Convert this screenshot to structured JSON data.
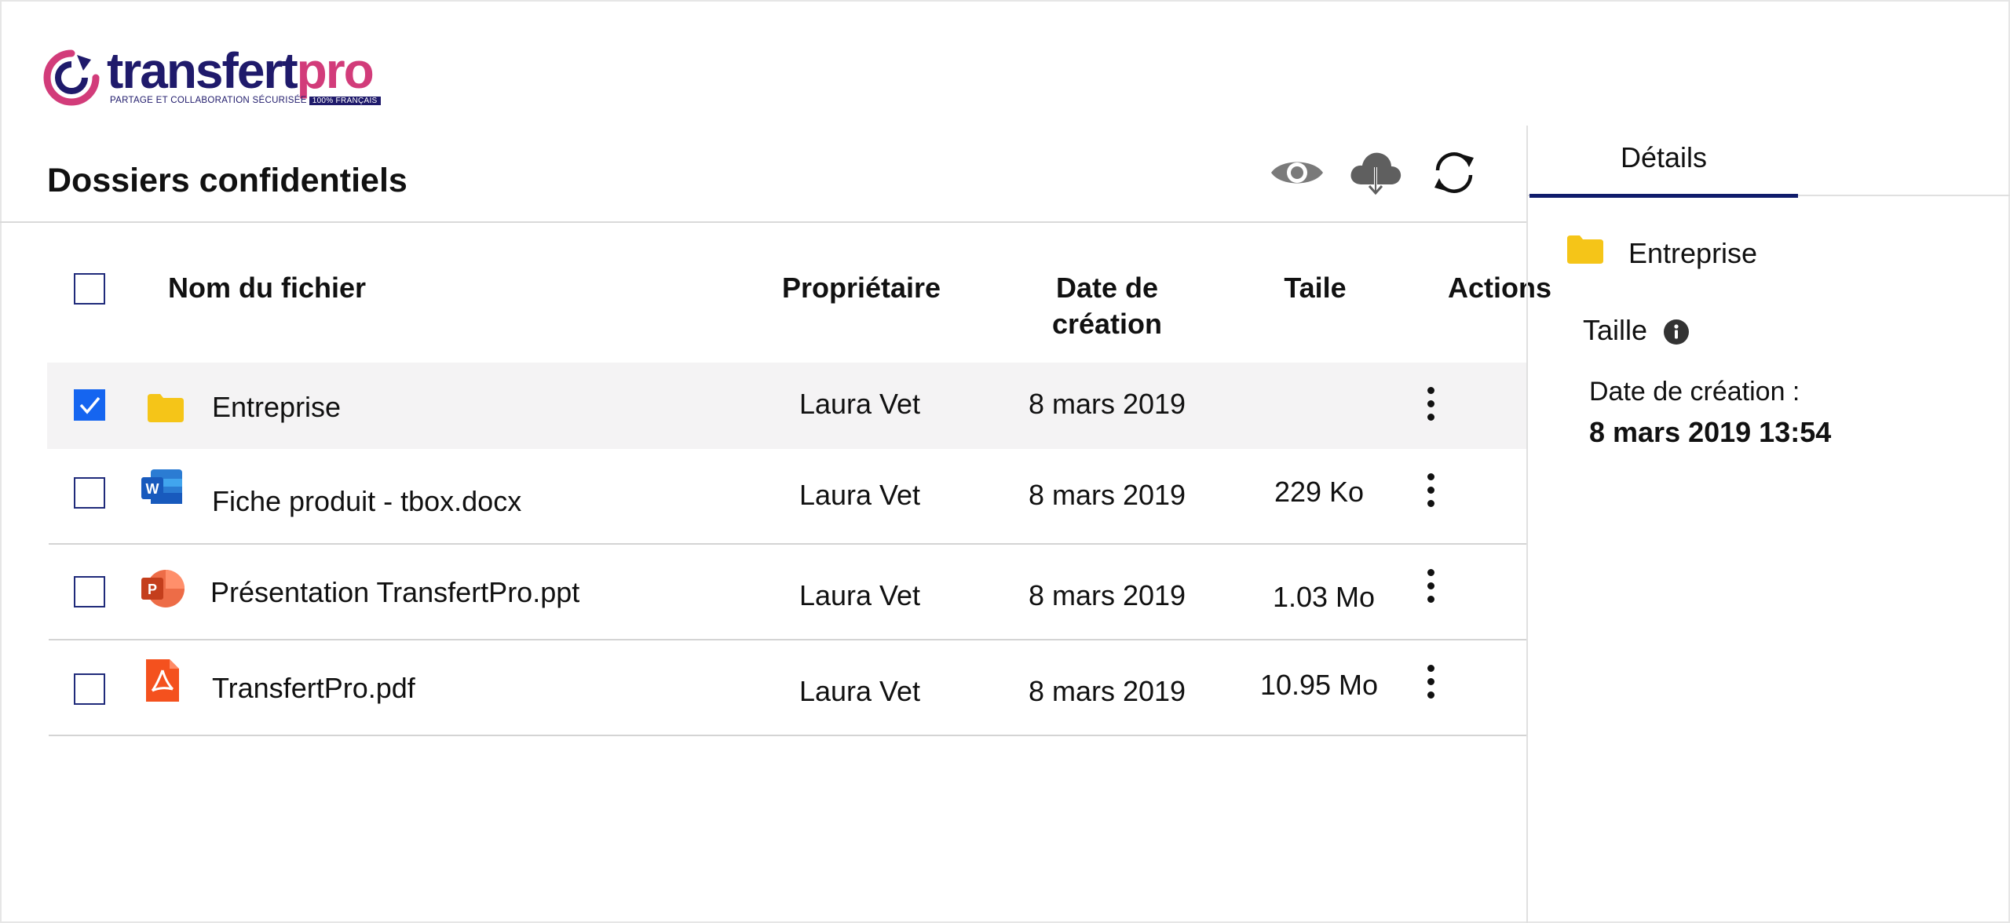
{
  "brand": {
    "name_part1": "transfert",
    "name_part2": "pro",
    "tagline": "PARTAGE ET COLLABORATION SÉCURISÉE",
    "badge": "100% FRANÇAIS",
    "colors": {
      "navy": "#1f1a6b",
      "pink": "#d23c7a"
    }
  },
  "page": {
    "title": "Dossiers confidentiels"
  },
  "toolbar": {
    "icons": [
      "eye-icon",
      "cloud-download-icon",
      "refresh-icon"
    ]
  },
  "table": {
    "columns": {
      "name": "Nom du fichier",
      "owner": "Propriétaire",
      "created_line1": "Date de",
      "created_line2": "création",
      "size": "Taile",
      "actions": "Actions"
    },
    "rows": [
      {
        "name": "Entreprise",
        "type": "folder",
        "owner": "Laura Vet",
        "date": "8 mars 2019",
        "size": "",
        "checked": true
      },
      {
        "name": "Fiche produit - tbox.docx",
        "type": "word",
        "owner": "Laura Vet",
        "date": "8 mars 2019",
        "size": "229 Ko",
        "checked": false
      },
      {
        "name": "Présentation TransfertPro.ppt",
        "type": "powerpoint",
        "owner": "Laura Vet",
        "date": "8 mars 2019",
        "size": "1.03 Mo",
        "checked": false
      },
      {
        "name": "TransfertPro.pdf",
        "type": "pdf",
        "owner": "Laura Vet",
        "date": "8 mars 2019",
        "size": "10.95 Mo",
        "checked": false
      }
    ]
  },
  "details": {
    "tab_label": "Détails",
    "item_name": "Entreprise",
    "size_label": "Taille",
    "date_label": "Date de création :",
    "date_value": "8 mars 2019 13:54"
  },
  "colors": {
    "accent": "#0f1c6b",
    "checkbox_checked": "#1565f0",
    "folder": "#f5c518",
    "selected_row": "#f4f3f4"
  }
}
